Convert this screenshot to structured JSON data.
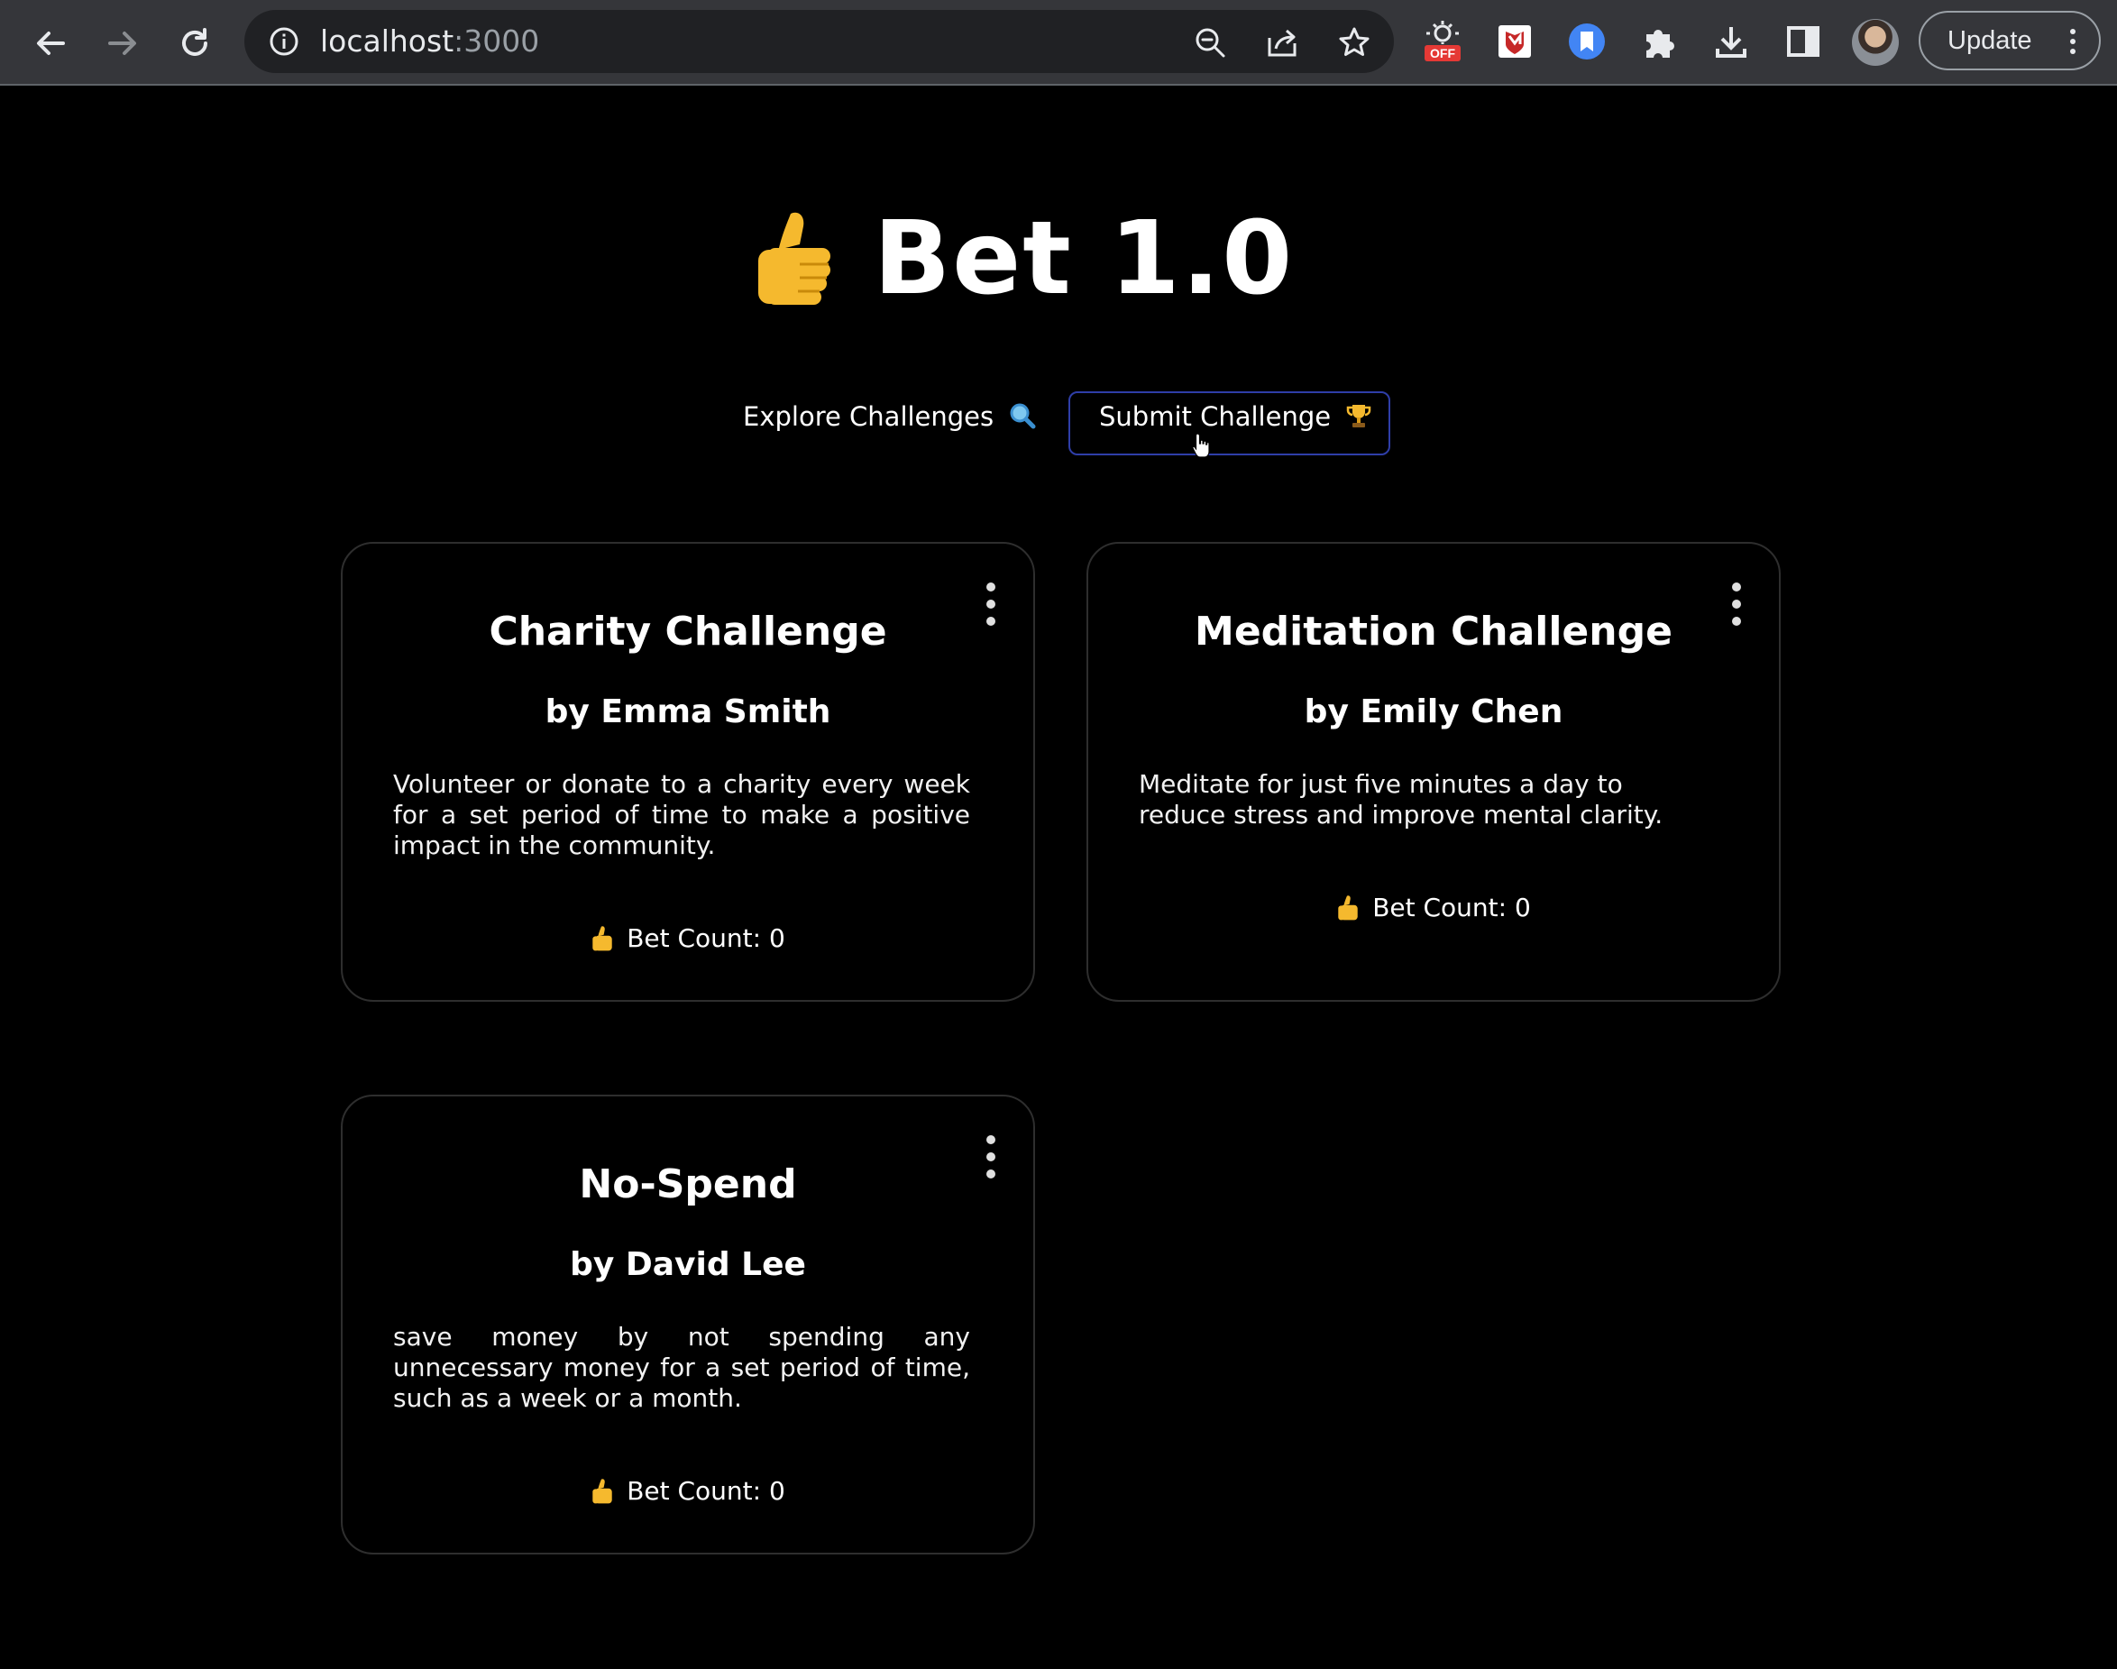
{
  "browser": {
    "url_host": "localhost",
    "url_port": ":3000",
    "ext_badge": "OFF",
    "update_label": "Update"
  },
  "page": {
    "title": "Bet 1.0",
    "title_icon": "thumbs-up-icon",
    "nav": {
      "explore_label": "Explore Challenges",
      "explore_icon": "magnifier-icon",
      "submit_label": "Submit Challenge",
      "submit_icon": "trophy-icon"
    }
  },
  "challenges": [
    {
      "title": "Charity Challenge",
      "author": "by Emma Smith",
      "description": "Volunteer or donate to a charity every week for a set period of time to make a positive impact in the community.",
      "bet_count": "Bet Count: 0"
    },
    {
      "title": "Meditation Challenge",
      "author": "by Emily Chen",
      "description": "Meditate for just five minutes a day to reduce stress and improve mental clarity.",
      "bet_count": "Bet Count: 0"
    },
    {
      "title": "No-Spend",
      "author": "by David Lee",
      "description": "save money by not spending any unnecessary money for a set period of time, such as a week or a month.",
      "bet_count": "Bet Count: 0"
    }
  ],
  "colors": {
    "background": "#000000",
    "text": "#ffffff",
    "submit_border": "#2f3ea8",
    "thumb": "#f5b92e"
  }
}
